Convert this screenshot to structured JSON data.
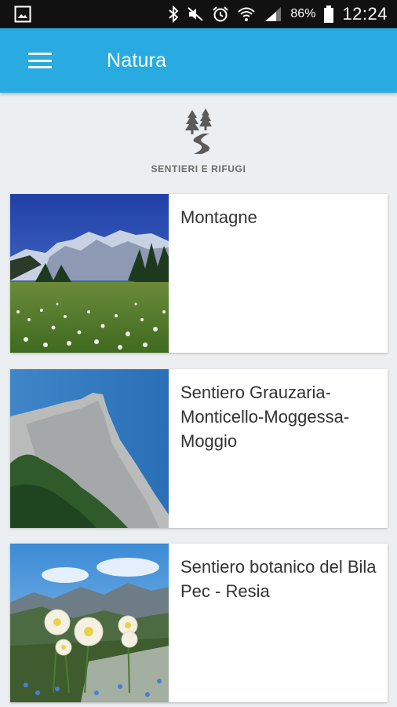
{
  "status_bar": {
    "battery": "86%",
    "time": "12:24",
    "icons": [
      "gallery-icon",
      "bluetooth-icon",
      "mute-icon",
      "alarm-icon",
      "wifi-icon",
      "signal-icon",
      "battery-icon"
    ]
  },
  "app_bar": {
    "title": "Natura",
    "menu_icon": "hamburger-menu-icon",
    "color": "#29abe2"
  },
  "category": {
    "icon": "trail-trees-icon",
    "label": "SENTIERI E RIFUGI"
  },
  "cards": [
    {
      "title": "Montagne",
      "image": "mountain-meadow-photo"
    },
    {
      "title": "Sentiero Grauzaria-Monticello-Moggessa-Moggio",
      "image": "rock-peak-photo"
    },
    {
      "title": "Sentiero botanico del Bila Pec - Resia",
      "image": "alpine-flowers-photo"
    }
  ]
}
